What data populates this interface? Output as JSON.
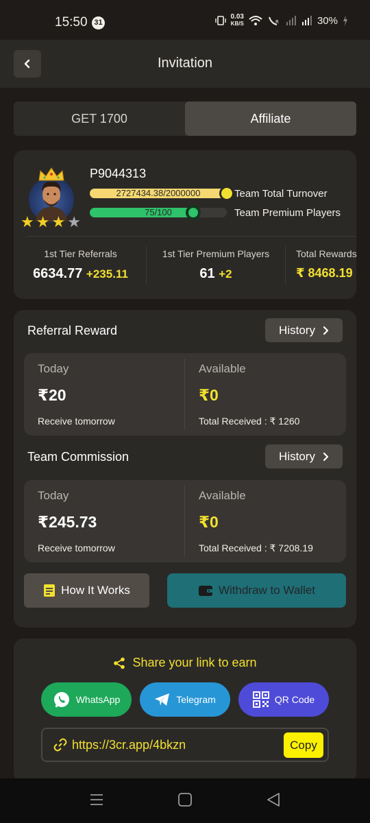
{
  "status_bar": {
    "time": "15:50",
    "notification_count": "31",
    "net_speed_value": "0.03",
    "net_speed_unit": "KB/S",
    "battery": "30%"
  },
  "header": {
    "title": "Invitation"
  },
  "tabs": [
    {
      "label": "GET 1700",
      "active": false
    },
    {
      "label": "Affiliate",
      "active": true
    }
  ],
  "profile": {
    "username": "P9044313",
    "turnover_progress_text": "2727434.38/2000000",
    "turnover_label": "Team Total Turnover",
    "premium_progress_text": "75/100",
    "premium_progress_fraction": 0.75,
    "premium_label": "Team Premium Players",
    "stars_filled": 3,
    "stars_total": 4,
    "stats": [
      {
        "label": "1st Tier Referrals",
        "value": "6634.77",
        "delta": "+235.11"
      },
      {
        "label": "1st Tier Premium Players",
        "value": "61",
        "delta": "+2"
      },
      {
        "label": "Total Rewards",
        "value": "₹ 8468.19",
        "delta": ""
      }
    ]
  },
  "referral_reward": {
    "title": "Referral Reward",
    "history_label": "History",
    "today_label": "Today",
    "today_amount": "₹20",
    "today_note": "Receive tomorrow",
    "available_label": "Available",
    "available_amount": "₹0",
    "available_note": "Total Received : ₹ 1260"
  },
  "team_commission": {
    "title": "Team Commission",
    "history_label": "History",
    "today_label": "Today",
    "today_amount": "₹245.73",
    "today_note": "Receive tomorrow",
    "available_label": "Available",
    "available_amount": "₹0",
    "available_note": "Total Received : ₹ 7208.19"
  },
  "actions": {
    "how_it_works": "How It Works",
    "withdraw": "Withdraw to Wallet"
  },
  "share": {
    "title": "Share your link to earn",
    "whatsapp": "WhatsApp",
    "telegram": "Telegram",
    "qr": "QR Code",
    "link": "https://3cr.app/4bkzn",
    "copy": "Copy"
  },
  "colors": {
    "accent_yellow": "#f2e030",
    "teal": "#1f6f76",
    "whatsapp_green": "#1da85a",
    "telegram_blue": "#2796d6",
    "qr_purple": "#4e4bd8",
    "progress_green": "#2ec26a"
  },
  "icons": [
    "back-chevron-icon",
    "crown-icon",
    "star-icon",
    "chevron-right-icon",
    "note-icon",
    "wallet-icon",
    "share-icon",
    "whatsapp-icon",
    "telegram-icon",
    "qr-code-icon",
    "link-icon",
    "menu-icon",
    "home-icon",
    "back-icon"
  ]
}
